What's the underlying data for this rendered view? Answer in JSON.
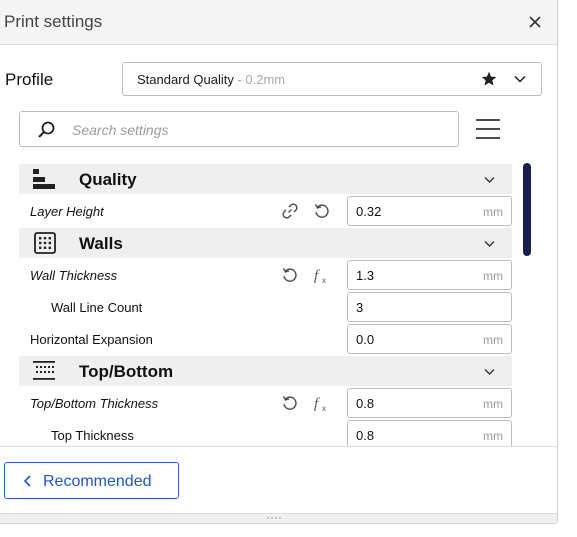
{
  "window": {
    "title": "Print settings"
  },
  "profile": {
    "label": "Profile",
    "name": "Standard Quality",
    "sub": " - 0.2mm"
  },
  "search": {
    "placeholder": "Search settings"
  },
  "categories": {
    "quality": {
      "label": "Quality",
      "icon": "quality-layers-icon"
    },
    "walls": {
      "label": "Walls",
      "icon": "walls-icon"
    },
    "top_bottom": {
      "label": "Top/Bottom",
      "icon": "top-bottom-icon"
    }
  },
  "settings": {
    "layer_height": {
      "label": "Layer Height",
      "value": "0.32",
      "unit": "mm"
    },
    "wall_thickness": {
      "label": "Wall Thickness",
      "value": "1.3",
      "unit": "mm"
    },
    "wall_line_count": {
      "label": "Wall Line Count",
      "value": "3"
    },
    "horizontal_expansion": {
      "label": "Horizontal Expansion",
      "value": "0.0",
      "unit": "mm"
    },
    "top_bottom_thickness": {
      "label": "Top/Bottom Thickness",
      "value": "0.8",
      "unit": "mm"
    },
    "top_thickness": {
      "label": "Top Thickness",
      "value": "0.8",
      "unit": "mm"
    }
  },
  "footer": {
    "recommended_label": "Recommended"
  },
  "colors": {
    "accent": "#1e55c9",
    "scrollbar": "#1a1f4d",
    "category_bg": "#efefef"
  }
}
